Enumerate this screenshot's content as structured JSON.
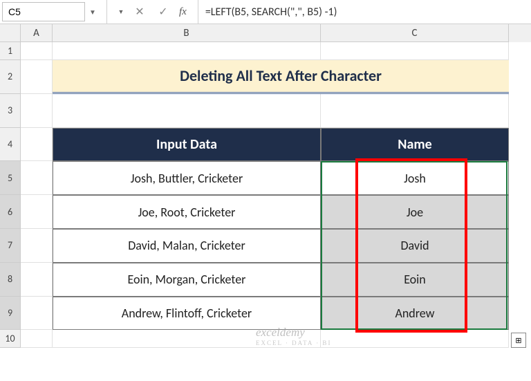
{
  "nameBox": {
    "value": "C5"
  },
  "formulaBar": {
    "formula": "=LEFT(B5, SEARCH(\",\", B5) -1)"
  },
  "columns": {
    "a": "A",
    "b": "B",
    "c": "C"
  },
  "rows": [
    "1",
    "2",
    "3",
    "4",
    "5",
    "6",
    "7",
    "8",
    "9",
    "10"
  ],
  "title": "Deleting All Text After Character",
  "headers": {
    "input": "Input Data",
    "name": "Name"
  },
  "chart_data": {
    "type": "table",
    "columns": [
      "Input Data",
      "Name"
    ],
    "rows": [
      {
        "input": "Josh, Buttler, Cricketer",
        "name": "Josh"
      },
      {
        "input": "Joe, Root, Cricketer",
        "name": "Joe"
      },
      {
        "input": "David, Malan, Cricketer",
        "name": "David"
      },
      {
        "input": "Eoin, Morgan, Cricketer",
        "name": "Eoin"
      },
      {
        "input": "Andrew, Flintoff, Cricketer",
        "name": "Andrew"
      }
    ]
  },
  "watermark": {
    "main": "exceldemy",
    "sub": "EXCEL · DATA · BI"
  },
  "fillHandle": "⊞"
}
